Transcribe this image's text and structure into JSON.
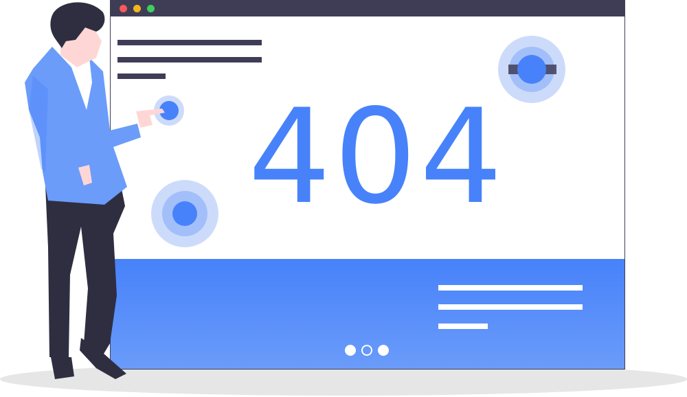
{
  "error_code": "404",
  "colors": {
    "accent": "#4782fa",
    "accent_light": "#6b9cfa",
    "ring_outer": "#cddbfb",
    "ring_middle": "#a3bffa",
    "dark": "#3f3d56",
    "window_close": "#f55a5a",
    "window_minimize": "#f5b61c",
    "window_maximize": "#3ecf5f",
    "shadow": "#e6e6e6"
  },
  "pager": {
    "count": 3,
    "active_index": 1
  }
}
